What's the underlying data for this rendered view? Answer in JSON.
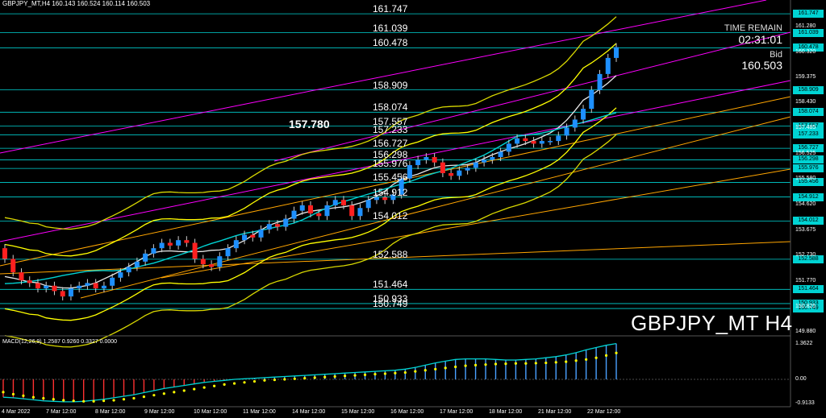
{
  "window": {
    "header": "GBPJPY_MT,H4  160.143 160.524 160.114 160.503",
    "macd_header": "MACD(12,26,9) 1.2587 0.9260 0.3327 0.0000",
    "symbol_label": "GBPJPY_MT H4"
  },
  "info_panel": {
    "time_remain_label": "TIME REMAIN",
    "countdown": "02:31:01",
    "bid_label": "Bid",
    "bid_value": "160.503"
  },
  "level_labels": [
    {
      "text": "161.747",
      "price": 161.747
    },
    {
      "text": "161.039",
      "price": 161.039
    },
    {
      "text": "160.478",
      "price": 160.478
    },
    {
      "text": "158.909",
      "price": 158.909
    },
    {
      "text": "158.074",
      "price": 158.074
    },
    {
      "text": "157.557",
      "price": 157.557
    },
    {
      "text": "157.233",
      "price": 157.233
    },
    {
      "text": "156.727",
      "price": 156.727
    },
    {
      "text": "156.298",
      "price": 156.298
    },
    {
      "text": "155.976",
      "price": 155.976
    },
    {
      "text": "155.456",
      "price": 155.456
    },
    {
      "text": "154.912",
      "price": 154.912
    },
    {
      "text": "154.012",
      "price": 154.012
    },
    {
      "text": "152.588",
      "price": 152.588
    },
    {
      "text": "151.464",
      "price": 151.464
    },
    {
      "text": "150.933",
      "price": 150.933
    },
    {
      "text": "150.749",
      "price": 150.749
    }
  ],
  "highlight_label": {
    "text": "157.780",
    "price": 157.78
  },
  "right_axis": {
    "tags": [
      "161.747",
      "161.039",
      "160.478",
      "158.909",
      "158.074",
      "157.557",
      "157.233",
      "156.727",
      "156.298",
      "155.976",
      "155.456",
      "154.912",
      "154.012",
      "152.588",
      "151.464",
      "150.933",
      "150.749"
    ],
    "plain": [
      {
        "text": "161.280",
        "price": 161.28
      },
      {
        "text": "160.320",
        "price": 160.32
      },
      {
        "text": "159.375",
        "price": 159.375
      },
      {
        "text": "158.430",
        "price": 158.43
      },
      {
        "text": "157.485",
        "price": 157.485
      },
      {
        "text": "156.525",
        "price": 156.525
      },
      {
        "text": "155.580",
        "price": 155.58
      },
      {
        "text": "154.620",
        "price": 154.62
      },
      {
        "text": "153.675",
        "price": 153.675
      },
      {
        "text": "152.730",
        "price": 152.73
      },
      {
        "text": "151.770",
        "price": 151.77
      },
      {
        "text": "150.825",
        "price": 150.825
      },
      {
        "text": "149.880",
        "price": 149.88
      }
    ]
  },
  "macd_axis": [
    "1.3622",
    "0.00",
    "-0.9133"
  ],
  "x_labels": [
    "4 Mar 2022",
    "7 Mar 12:00",
    "8 Mar 12:00",
    "9 Mar 12:00",
    "10 Mar 12:00",
    "11 Mar 12:00",
    "14 Mar 12:00",
    "15 Mar 12:00",
    "16 Mar 12:00",
    "17 Mar 12:00",
    "18 Mar 12:00",
    "21 Mar 12:00",
    "22 Mar 12:00"
  ],
  "colors": {
    "background": "#000000",
    "level_line": "#00d3d3",
    "bull_candle": "#1e90ff",
    "bear_candle": "#ff2020",
    "bands": "#ffff00",
    "trend_magenta": "#ff00ff",
    "trend_orange": "#ffa500",
    "macd_signal_dots": "#ffff00",
    "macd_line": "#00d3d3",
    "histogram": "#4aa0ff"
  },
  "chart_data": {
    "type": "candlestick",
    "symbol": "GBPJPY_MT",
    "timeframe": "H4",
    "ylim": [
      149.88,
      161.9
    ],
    "ohlc_last": {
      "open": 160.143,
      "high": 160.524,
      "low": 160.114,
      "close": 160.503
    },
    "closes": [
      152.6,
      152.1,
      151.8,
      151.7,
      151.5,
      151.6,
      151.4,
      151.2,
      151.5,
      151.6,
      151.7,
      151.5,
      151.6,
      151.9,
      152.1,
      152.3,
      152.5,
      152.8,
      153.0,
      153.2,
      153.1,
      153.3,
      153.2,
      152.6,
      152.4,
      152.3,
      152.7,
      153.0,
      153.3,
      153.5,
      153.4,
      153.7,
      153.9,
      153.8,
      154.1,
      154.4,
      154.6,
      154.3,
      154.2,
      154.6,
      154.8,
      154.6,
      154.2,
      154.5,
      154.8,
      154.9,
      154.8,
      155.0,
      155.6,
      156.1,
      156.3,
      156.4,
      156.2,
      155.8,
      155.7,
      155.9,
      156.0,
      156.2,
      156.3,
      156.4,
      156.6,
      156.9,
      157.1,
      157.0,
      156.9,
      157.0,
      157.0,
      157.2,
      157.5,
      157.8,
      158.2,
      158.9,
      159.5,
      160.1,
      160.5
    ],
    "macd": [
      -0.7,
      -0.72,
      -0.76,
      -0.8,
      -0.84,
      -0.86,
      -0.88,
      -0.88,
      -0.86,
      -0.82,
      -0.78,
      -0.72,
      -0.66,
      -0.6,
      -0.52,
      -0.44,
      -0.36,
      -0.3,
      -0.24,
      -0.18,
      -0.12,
      -0.08,
      -0.04,
      0.0,
      0.02,
      0.04,
      0.06,
      0.08,
      0.1,
      0.12,
      0.14,
      0.16,
      0.18,
      0.2,
      0.22,
      0.24,
      0.26,
      0.28,
      0.3,
      0.32,
      0.36,
      0.42,
      0.5,
      0.58,
      0.64,
      0.7,
      0.72,
      0.72,
      0.72,
      0.7,
      0.68,
      0.68,
      0.7,
      0.72,
      0.76,
      0.8,
      0.86,
      0.94,
      1.04,
      1.12,
      1.2,
      1.26
    ],
    "signal": [
      -0.5,
      -0.58,
      -0.64,
      -0.7,
      -0.74,
      -0.78,
      -0.82,
      -0.84,
      -0.86,
      -0.86,
      -0.84,
      -0.82,
      -0.78,
      -0.74,
      -0.68,
      -0.62,
      -0.56,
      -0.5,
      -0.44,
      -0.38,
      -0.32,
      -0.26,
      -0.2,
      -0.16,
      -0.12,
      -0.08,
      -0.04,
      -0.02,
      0.0,
      0.02,
      0.04,
      0.06,
      0.08,
      0.1,
      0.12,
      0.14,
      0.16,
      0.18,
      0.2,
      0.22,
      0.24,
      0.28,
      0.32,
      0.36,
      0.4,
      0.44,
      0.48,
      0.5,
      0.52,
      0.54,
      0.55,
      0.56,
      0.56,
      0.57,
      0.58,
      0.6,
      0.62,
      0.66,
      0.7,
      0.76,
      0.84,
      0.93
    ]
  }
}
